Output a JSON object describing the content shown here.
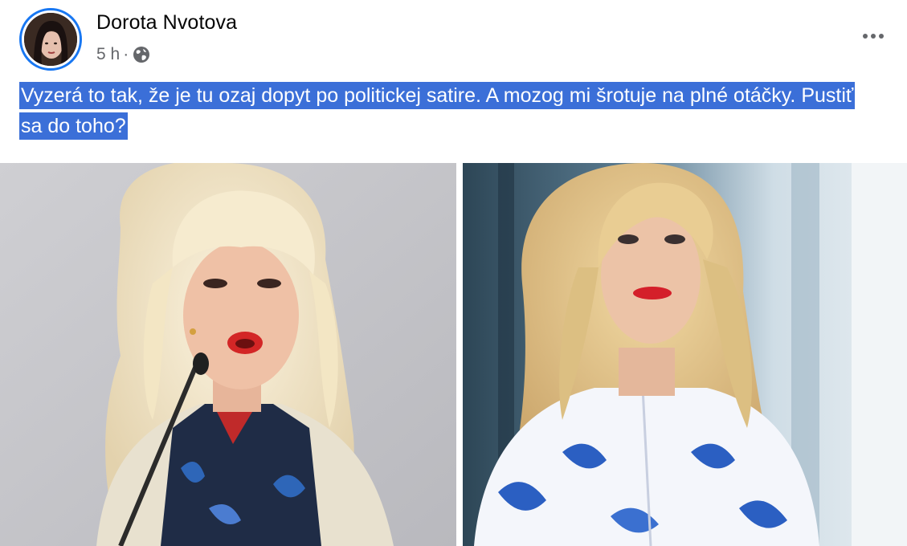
{
  "post": {
    "author": "Dorota Nvotova",
    "time": "5 h",
    "separator": "·",
    "audience_icon": "globe-icon",
    "menu_icon": "more-options-icon",
    "text": "Vyzerá to tak, že je tu ozaj dopyt po politickej satire. A mozog mi šrotuje na plné otáčky. Pustiť sa do toho?"
  },
  "colors": {
    "selection_highlight": "#3b6fd8",
    "avatar_ring": "#1877f2",
    "meta_text": "#65676b"
  }
}
